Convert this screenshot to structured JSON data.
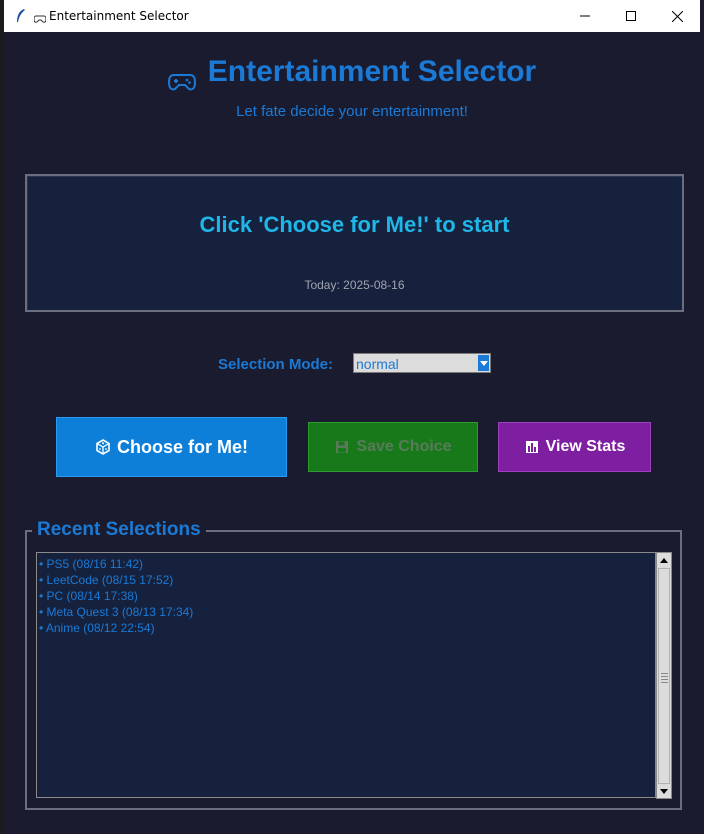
{
  "window": {
    "title": "Entertainment Selector",
    "controls": {
      "minimize": "—",
      "maximize": "☐",
      "close": "✕"
    }
  },
  "header": {
    "title": "Entertainment Selector",
    "subtitle": "Let fate decide your entertainment!",
    "icon": "gamepad-icon"
  },
  "result": {
    "message": "Click 'Choose for Me!' to start",
    "today": "Today: 2025-08-16"
  },
  "mode": {
    "label": "Selection Mode:",
    "selected": "normal"
  },
  "buttons": {
    "choose": "Choose for Me!",
    "save": "Save Choice",
    "stats": "View Stats"
  },
  "recent": {
    "title": "Recent Selections",
    "items": [
      "• PS5 (08/16 11:42)",
      "• LeetCode (08/15 17:52)",
      "• PC (08/14 17:38)",
      "• Meta Quest 3 (08/13 17:34)",
      "• Anime (08/12 22:54)"
    ]
  },
  "colors": {
    "accent": "#1a7ad6",
    "result_text": "#1fb6e8",
    "background": "#1a1b2e",
    "panel": "#16213e",
    "choose_button": "#0d7fd9",
    "save_button": "#17791a",
    "stats_button": "#7e1fa2"
  }
}
